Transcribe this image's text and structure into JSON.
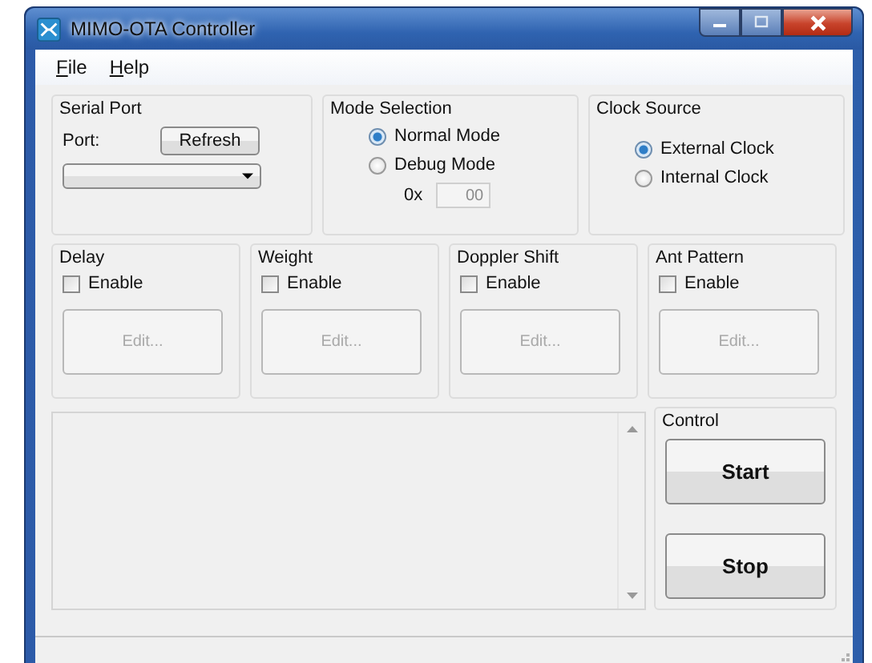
{
  "window": {
    "title": "MIMO-OTA Controller"
  },
  "menu": [
    {
      "label": "File"
    },
    {
      "label": "Help"
    }
  ],
  "serial_port": {
    "title": "Serial Port",
    "port_label": "Port:",
    "refresh_button": "Refresh"
  },
  "mode_selection": {
    "title": "Mode Selection",
    "options": [
      {
        "label": "Normal Mode",
        "selected": true
      },
      {
        "label": "Debug Mode",
        "selected": false
      }
    ],
    "hex_prefix": "0x",
    "hex_value": "00",
    "hex_disabled": true
  },
  "clock_source": {
    "title": "Clock Source",
    "options": [
      {
        "label": "External Clock",
        "selected": true
      },
      {
        "label": "Internal Clock",
        "selected": false
      }
    ]
  },
  "effects": [
    {
      "title": "Delay",
      "enable_label": "Enable",
      "checked": false,
      "edit_button": "Edit...",
      "edit_disabled": true
    },
    {
      "title": "Weight",
      "enable_label": "Enable",
      "checked": false,
      "edit_button": "Edit...",
      "edit_disabled": true
    },
    {
      "title": "Doppler Shift",
      "enable_label": "Enable",
      "checked": false,
      "edit_button": "Edit...",
      "edit_disabled": true
    },
    {
      "title": "Ant Pattern",
      "enable_label": "Enable",
      "checked": false,
      "edit_button": "Edit...",
      "edit_disabled": true
    }
  ],
  "control": {
    "title": "Control",
    "buttons": [
      "Start",
      "Stop"
    ]
  }
}
